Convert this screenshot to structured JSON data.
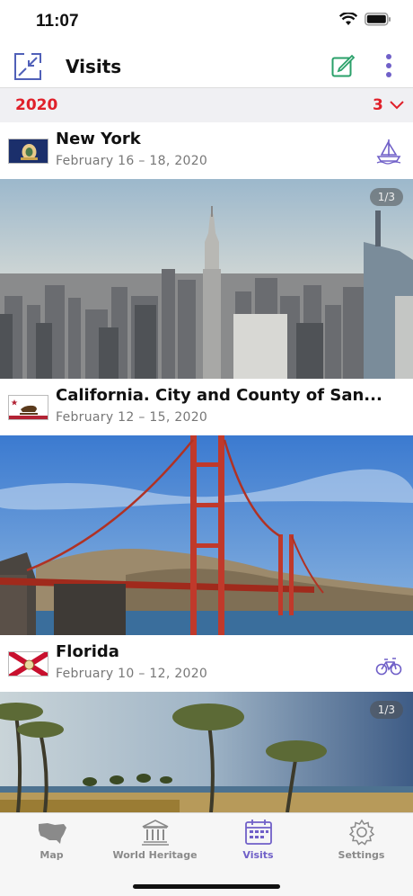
{
  "status_bar": {
    "time": "11:07"
  },
  "nav": {
    "title": "Visits"
  },
  "year_group": {
    "year": "2020",
    "count": "3"
  },
  "visits": [
    {
      "name": "New York",
      "dates": "February 16 – 18, 2020",
      "transport": "sailboat-icon",
      "photo_counter": "1/3",
      "photo": "new-york-skyline"
    },
    {
      "name": "California. City and County of San...",
      "dates": "February 12 – 15, 2020",
      "transport": "",
      "photo_counter": "",
      "photo": "golden-gate-bridge"
    },
    {
      "name": "Florida",
      "dates": "February 10 – 12, 2020",
      "transport": "bicycle-icon",
      "photo_counter": "1/3",
      "photo": "palm-beach"
    }
  ],
  "flags": {
    "0": "PENNSYLVANIA"
  },
  "tabs": [
    {
      "label": "Map",
      "icon": "usa-map-icon",
      "active": false
    },
    {
      "label": "World Heritage",
      "icon": "temple-icon",
      "active": false
    },
    {
      "label": "Visits",
      "icon": "calendar-icon",
      "active": true
    },
    {
      "label": "Settings",
      "icon": "gear-icon",
      "active": false
    }
  ],
  "colors": {
    "accent": "#7060c8",
    "year": "#e0202a",
    "edit": "#2aa06a"
  }
}
